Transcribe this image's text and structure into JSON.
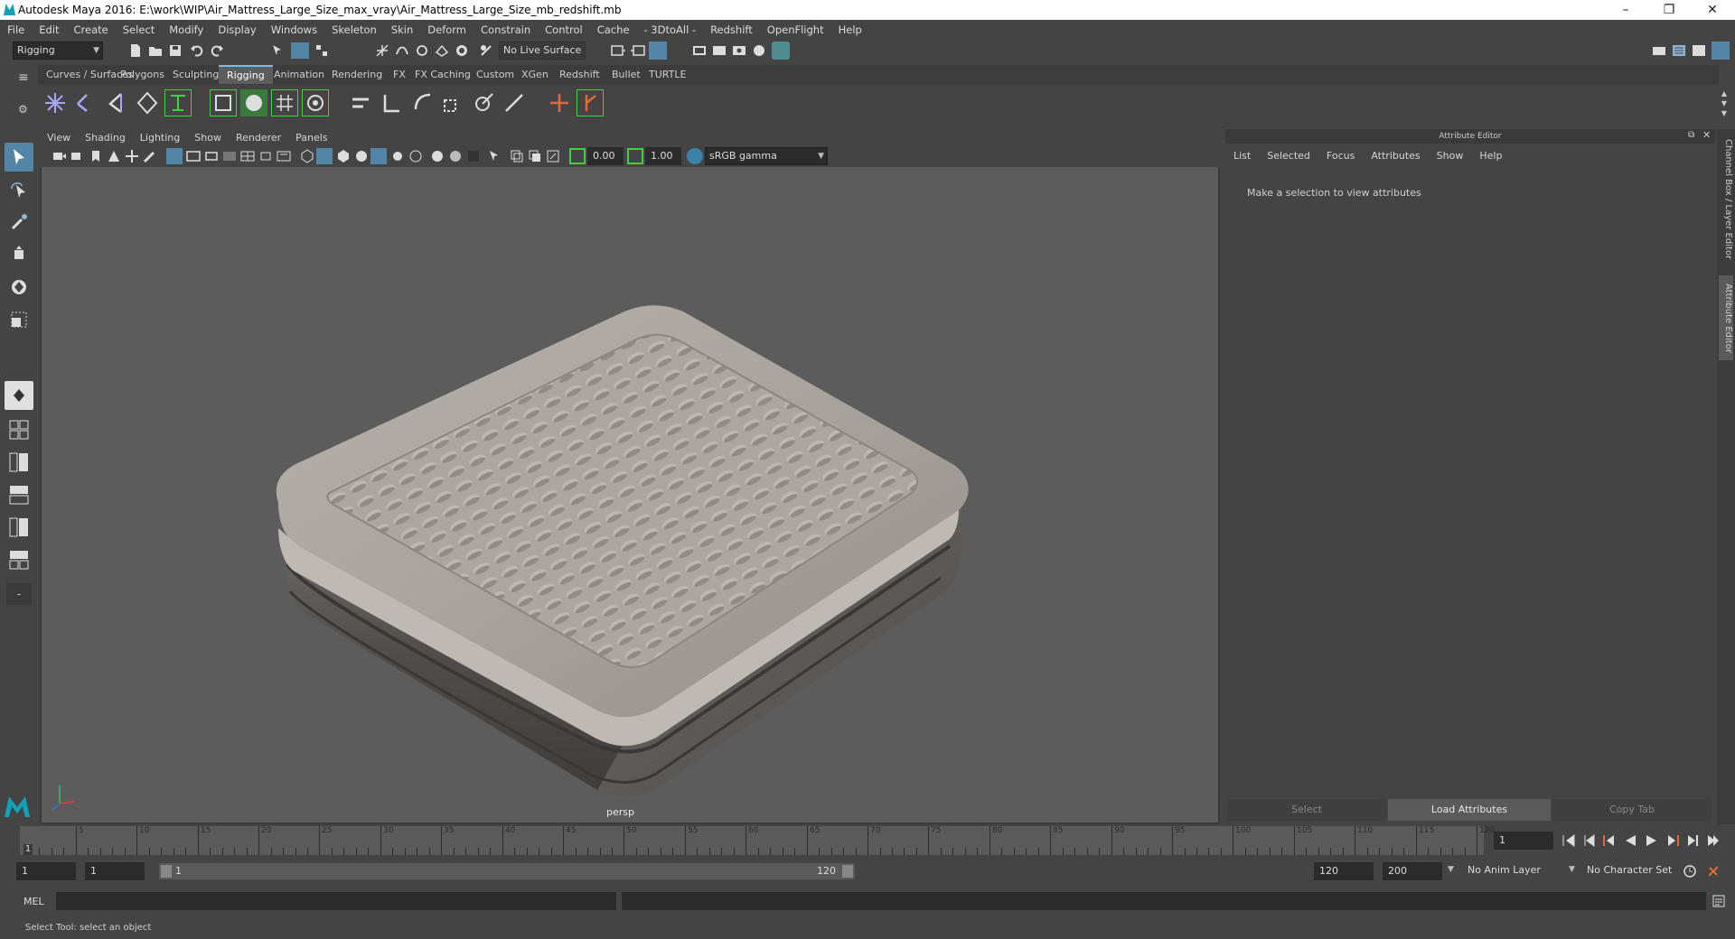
{
  "window": {
    "title": "Autodesk Maya 2016: E:\\work\\WIP\\Air_Mattress_Large_Size_max_vray\\Air_Mattress_Large_Size_mb_redshift.mb",
    "minimize": "–",
    "restore": "❐",
    "close": "✕"
  },
  "menubar": [
    "File",
    "Edit",
    "Create",
    "Select",
    "Modify",
    "Display",
    "Windows",
    "Skeleton",
    "Skin",
    "Deform",
    "Constrain",
    "Control",
    "Cache",
    "- 3DtoAll -",
    "Redshift",
    "OpenFlight",
    "Help"
  ],
  "statusline": {
    "mode": "Rigging",
    "live_surface": "No Live Surface"
  },
  "shelf_tabs": [
    {
      "label": "Curves / Surfaces",
      "active": false
    },
    {
      "label": "Polygons",
      "active": false
    },
    {
      "label": "Sculpting",
      "active": false
    },
    {
      "label": "Rigging",
      "active": true
    },
    {
      "label": "Animation",
      "active": false
    },
    {
      "label": "Rendering",
      "active": false
    },
    {
      "label": "FX",
      "active": false
    },
    {
      "label": "FX Caching",
      "active": false
    },
    {
      "label": "Custom",
      "active": false
    },
    {
      "label": "XGen",
      "active": false
    },
    {
      "label": "Redshift",
      "active": false
    },
    {
      "label": "Bullet",
      "active": false
    },
    {
      "label": "TURTLE",
      "active": false
    }
  ],
  "panel_menu": [
    "View",
    "Shading",
    "Lighting",
    "Show",
    "Renderer",
    "Panels"
  ],
  "panel_tools": {
    "exposure": "0.00",
    "gamma": "1.00",
    "color_space": "sRGB gamma"
  },
  "viewport": {
    "camera_label": "persp"
  },
  "attribute_editor": {
    "title": "Attribute Editor",
    "menu": [
      "List",
      "Selected",
      "Focus",
      "Attributes",
      "Show",
      "Help"
    ],
    "message": "Make a selection to view attributes",
    "buttons": {
      "select": "Select",
      "load": "Load Attributes",
      "copy": "Copy Tab"
    }
  },
  "side_tabs": {
    "channel_box": "Channel Box / Layer Editor",
    "attribute_editor": "Attribute Editor"
  },
  "timeline": {
    "labels": [
      "5",
      "10",
      "15",
      "20",
      "25",
      "30",
      "35",
      "40",
      "45",
      "50",
      "55",
      "60",
      "65",
      "70",
      "75",
      "80",
      "85",
      "90",
      "95",
      "100",
      "105",
      "110",
      "115",
      "120"
    ],
    "start_marker": "1",
    "current_frame": "1"
  },
  "range": {
    "start": "1",
    "playback_start": "1",
    "slider_start": "1",
    "slider_end": "120",
    "playback_end": "120",
    "end": "200",
    "anim_layer": "No Anim Layer",
    "character_set": "No Character Set"
  },
  "command_line": {
    "label": "MEL"
  },
  "help_line": {
    "text": "Select Tool: select an object"
  },
  "colors": {
    "accent": "#5285a6",
    "shelf_green": "#3fd13f",
    "viewport_bg": "#5c5c5c"
  }
}
